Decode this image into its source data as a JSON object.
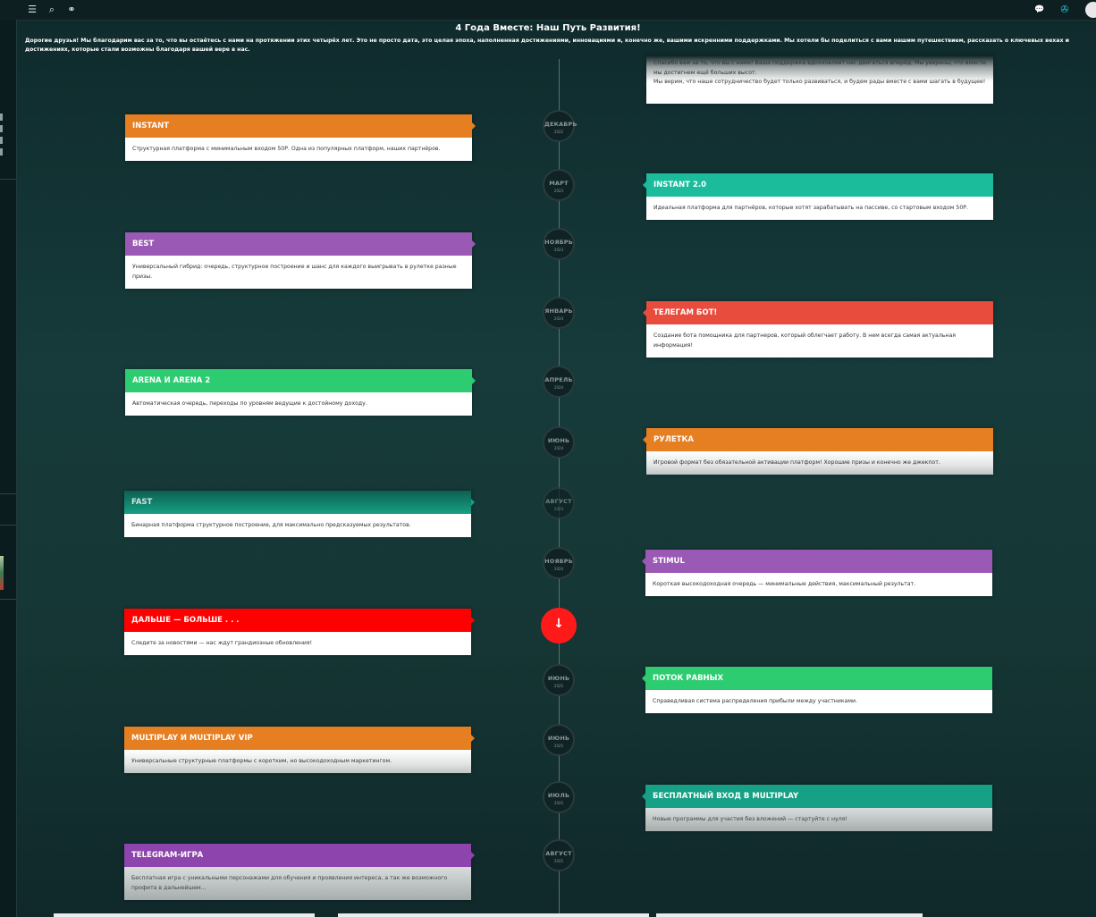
{
  "topbar": {
    "icons": [
      "menu-icon",
      "search-icon",
      "link-icon",
      "chat-icon",
      "pin-icon"
    ],
    "glyphs": {
      "menu": "☰",
      "search": "⌕",
      "link": "⚭",
      "chat": "💬",
      "pin": "✇"
    }
  },
  "page": {
    "title": "4 Года Вместе: Наш Путь Развития!",
    "intro": "Дорогие друзья! Мы благодарим вас за то, что вы остаётесь с нами на протяжении этих четырёх лет. Это не просто дата, это целая эпоха, наполненная достижениями, инновациями и, конечно же, вашими искренними поддержками. Мы хотели бы поделиться с вами нашим путешествием, рассказать о ключевых вехах и достижениях, которые стали возможны благодаря вашей вере в нас."
  },
  "top_card": {
    "line1": "Спасибо вам за то, что вы с нами! Ваша поддержка вдохновляет нас двигаться вперёд. Мы уверены, что вместе мы достигнем ещё больших высот.",
    "line2": "Мы верим, что наше сотрудничество будет только развиваться, и будем рады вместе с вами шагать в будущее!"
  },
  "timeline": [
    {
      "month": "ДЕКАБРЬ",
      "year": "2022",
      "side": "left",
      "title": "INSTANT",
      "color": "#e67e22",
      "text": "Структурная платформа с минимальным входом 50Р. Одна из популярных платформ, наших партнёров."
    },
    {
      "month": "МАРТ",
      "year": "2023",
      "side": "right",
      "title": "INSTANT 2.0",
      "color": "#1abc9c",
      "text": "Идеальная платформа для партнёров, которые хотят зарабатывать на пассиве, со стартовым входом 50Р."
    },
    {
      "month": "НОЯБРЬ",
      "year": "2023",
      "side": "left",
      "title": "BEST",
      "color": "#9b59b6",
      "text": "Универсальный гибрид: очередь, структурное построение и шанс для каждого выигрывать в рулетке разные призы."
    },
    {
      "month": "ЯНВАРЬ",
      "year": "2024",
      "side": "right",
      "title": "ТЕЛЕГАМ БОТ!",
      "color": "#e74c3c",
      "text": "Создание бота помощника для партнеров, который облегчает работу. В нем всегда самая актуальная информация!"
    },
    {
      "month": "АПРЕЛЬ",
      "year": "2024",
      "side": "left",
      "title": "ARENA И ARENA 2",
      "color": "#2ecc71",
      "text": "Автоматическая очередь, переходы по уровням ведущие к достойному доходу."
    },
    {
      "month": "ИЮНЬ",
      "year": "2024",
      "side": "right",
      "title": "РУЛЕТКА",
      "color": "#e67e22",
      "text": "Игровой формат без обязательной активации платформ! Хорошие призы и конечно же джекпот."
    },
    {
      "month": "АВГУСТ",
      "year": "2024",
      "side": "left",
      "title": "FAST",
      "color": "#16a085",
      "text": "Бинарная платформа структурное построение, для максимально предсказуемых результатов."
    },
    {
      "month": "НОЯБРЬ",
      "year": "2024",
      "side": "right",
      "title": "STIMUL",
      "color": "#9b59b6",
      "text": "Короткая высокодоходная очередь — минимальные действия, максимальный результат."
    },
    {
      "month": "",
      "year": "",
      "side": "left",
      "title": "ДАЛЬШЕ — БОЛЬШЕ . . .",
      "color": "#ff0000",
      "text": "Следите за новостями — нас ждут грандиозные обновления!"
    },
    {
      "month": "ИЮНЬ",
      "year": "2025",
      "side": "right",
      "title": "ПОТОК РАВНЫХ",
      "color": "#2ecc71",
      "text": "Справедливая система распределения прибыли между участниками."
    },
    {
      "month": "ИЮНЬ",
      "year": "2025",
      "side": "left",
      "title": "MULTIPLAY И MULTIPLAY VIP",
      "color": "#e67e22",
      "text": "Универсальные структурные платформы с коротким, но высокодоходным маркетингом."
    },
    {
      "month": "ИЮЛЬ",
      "year": "2025",
      "side": "right",
      "title": "БЕСПЛАТНЫЙ ВХОД В MULTIPLAY",
      "color": "#16a085",
      "text": "Новые программы для участия без вложений — стартуйте с нуля!"
    },
    {
      "month": "АВГУСТ",
      "year": "2025",
      "side": "left",
      "title": "TELEGRAM-ИГРА",
      "color": "#8e44ad",
      "text": "Бесплатная игра с уникальными персонажами для обучения и проявления интереса, а так же возможного профита в дальнейшем..."
    }
  ],
  "special_node_glyph": "↓"
}
